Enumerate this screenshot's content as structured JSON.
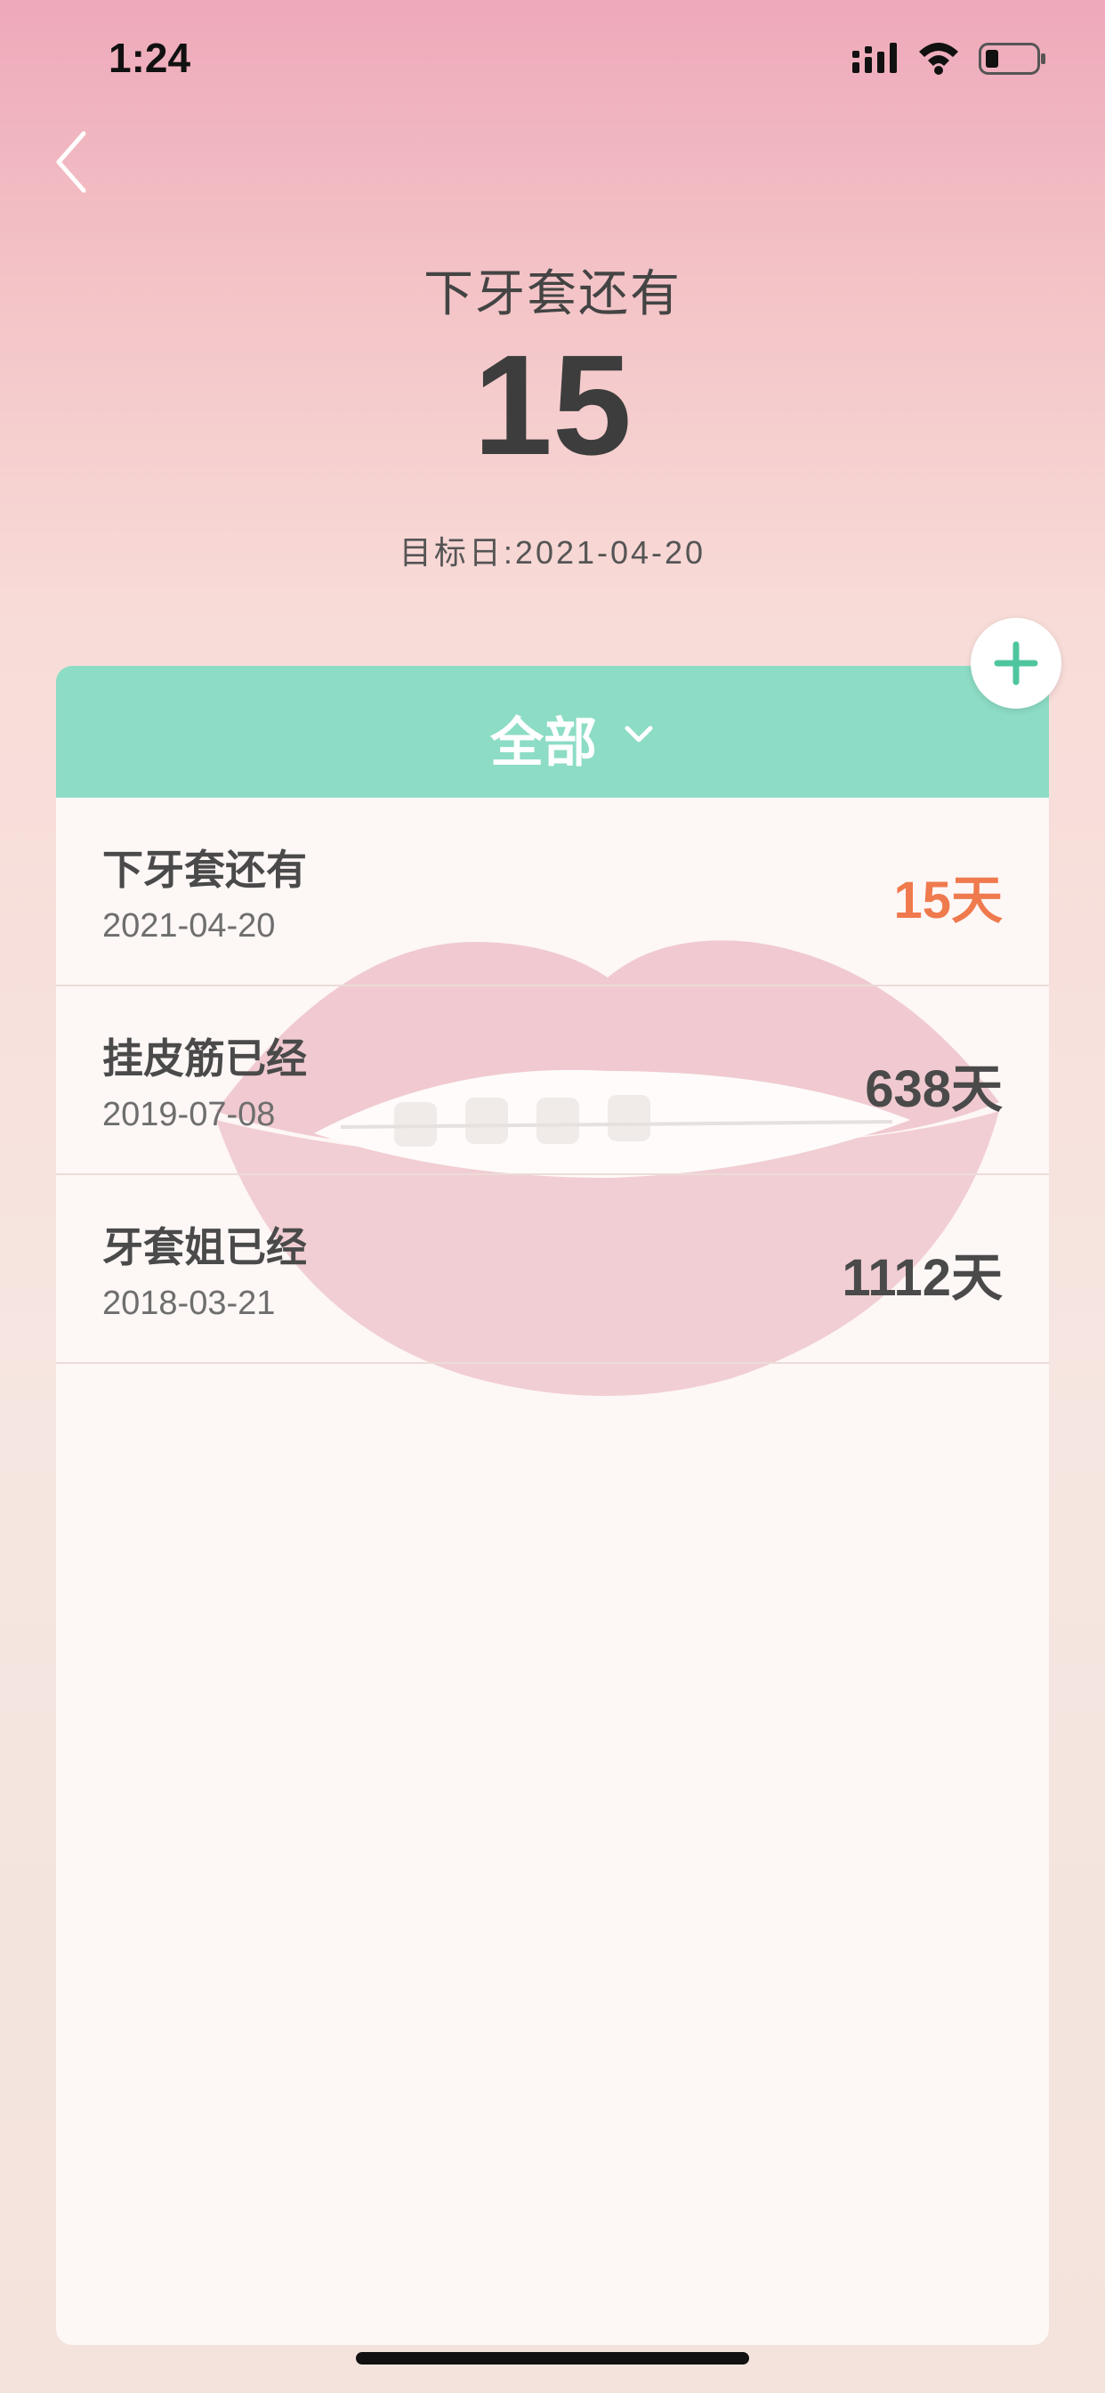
{
  "status_bar": {
    "time": "1:24"
  },
  "hero": {
    "title": "下牙套还有",
    "count": "15",
    "target_label": "目标日:",
    "target_date": "2021-04-20"
  },
  "filter": {
    "label": "全部"
  },
  "events": [
    {
      "title": "下牙套还有",
      "date": "2021-04-20",
      "count": "15天",
      "highlight": true
    },
    {
      "title": "挂皮筋已经",
      "date": "2019-07-08",
      "count": "638天",
      "highlight": false
    },
    {
      "title": "牙套姐已经",
      "date": "2018-03-21",
      "count": "1112天",
      "highlight": false
    }
  ],
  "colors": {
    "accent_green": "#8ddcc5",
    "highlight_orange": "#ef7a4e",
    "text_dark": "#3d3d3d"
  },
  "icons": [
    "back-icon",
    "add-icon",
    "chevron-down-icon",
    "signal-icon",
    "wifi-icon",
    "battery-icon"
  ]
}
